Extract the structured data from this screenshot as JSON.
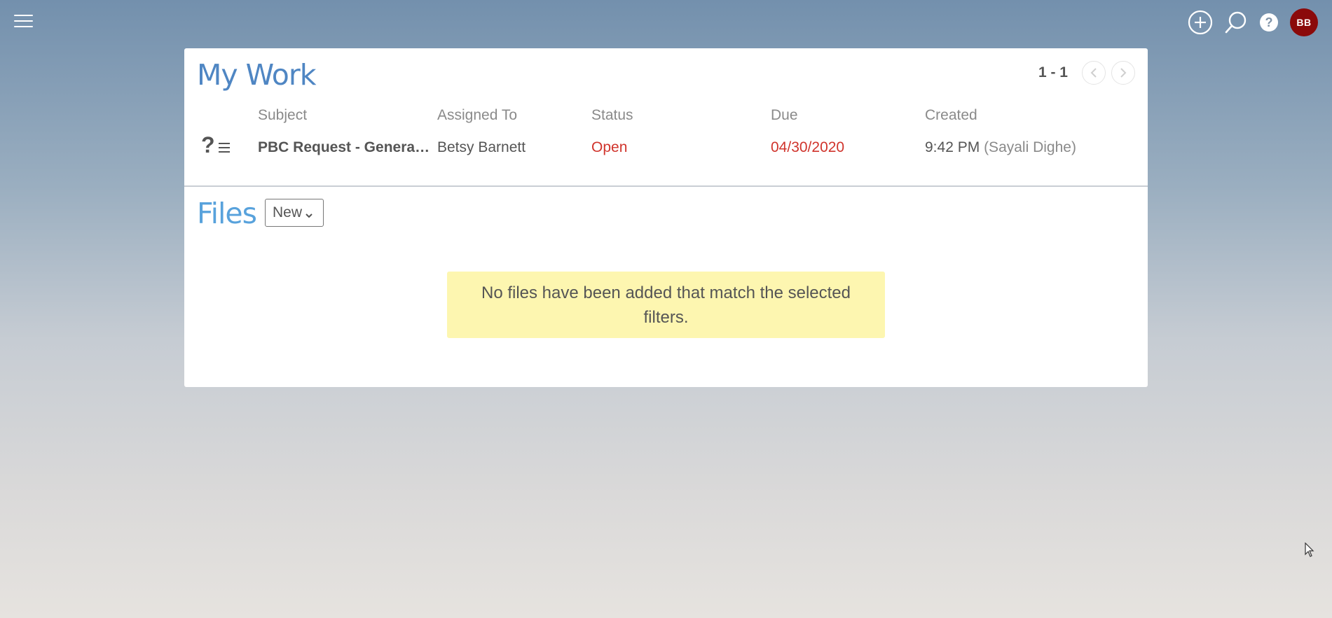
{
  "topbar": {
    "menu_icon": "hamburger-icon",
    "actions": [
      {
        "name": "add",
        "icon": "plus-circle-icon"
      },
      {
        "name": "search",
        "icon": "search-icon"
      },
      {
        "name": "help",
        "icon": "help-icon"
      }
    ],
    "avatar_initials": "BB",
    "avatar_color": "#8b0a0a"
  },
  "my_work": {
    "title": "My Work",
    "pager_range": "1 - 1",
    "columns": [
      "Subject",
      "Assigned To",
      "Status",
      "Due",
      "Created"
    ],
    "rows": [
      {
        "icon": "question-list-icon",
        "icon_text": "?",
        "subject": "PBC Request - General I...",
        "assigned_to": "Betsy Barnett",
        "status": "Open",
        "due": "04/30/2020",
        "created_time": "9:42 PM",
        "created_by": "(Sayali Dighe)"
      }
    ]
  },
  "files": {
    "title": "Files",
    "new_button_label": "New",
    "empty_message": "No files have been added that match the selected filters."
  },
  "colors": {
    "title_blue": "#4f86c3",
    "alert_red": "#d0342c",
    "empty_bg": "#fdf6b0"
  }
}
